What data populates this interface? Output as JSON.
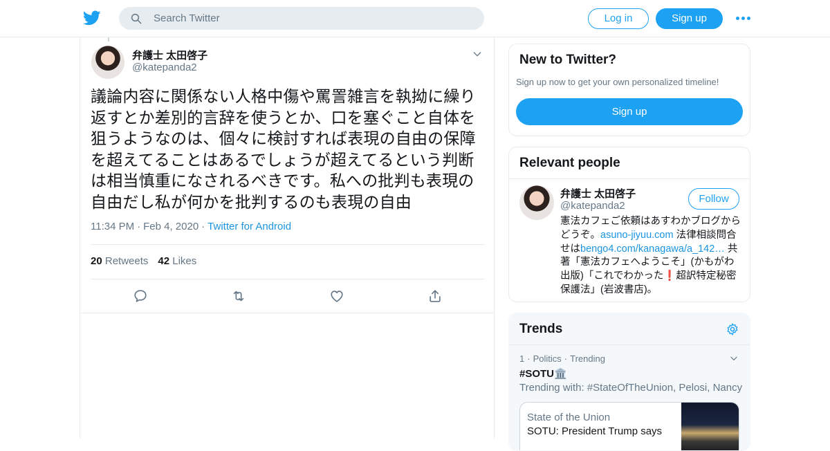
{
  "header": {
    "search_placeholder": "Search Twitter",
    "login_label": "Log in",
    "signup_label": "Sign up"
  },
  "tweet": {
    "author_name": "弁護士 太田啓子",
    "author_handle": "@katepanda2",
    "text": "議論内容に関係ない人格中傷や罵詈雑言を執拗に繰り返すとか差別的言辞を使うとか、口を塞ぐこと自体を狙うようなのは、個々に検討すれば表現の自由の保障を超えてることはあるでしょうが超えてるという判断は相当慎重になされるべきです。私への批判も表現の自由だし私が何かを批判するのも表現の自由",
    "time": "11:34 PM",
    "date": "Feb 4, 2020",
    "source": "Twitter for Android",
    "retweets_count": "20",
    "retweets_label": "Retweets",
    "likes_count": "42",
    "likes_label": "Likes"
  },
  "new_to_twitter": {
    "title": "New to Twitter?",
    "subtitle": "Sign up now to get your own personalized timeline!",
    "button": "Sign up"
  },
  "relevant_people": {
    "title": "Relevant people",
    "person": {
      "name": "弁護士 太田啓子",
      "handle": "@katepanda2",
      "follow_label": "Follow",
      "bio_part1": "憲法カフェご依頼はあすわかブログからどうぞ。",
      "bio_link1": "asuno-jiyuu.com",
      "bio_part2": " 法律相談問合せは",
      "bio_link2": "bengo4.com/kanagawa/a_142…",
      "bio_part3": " 共著「憲法カフェへようこそ」(かもがわ出版)「これでわかった",
      "bio_exclaim": "❗",
      "bio_part4": "超訳特定秘密保護法」(岩波書店)。"
    }
  },
  "trends": {
    "title": "Trends",
    "item": {
      "rank": "1",
      "category": "Politics",
      "status": "Trending",
      "tag": "#SOTU🏛️",
      "trending_with": "Trending with: #StateOfTheUnion, Pelosi, Nancy",
      "news_source": "State of the Union",
      "news_title": "SOTU: President Trump says"
    }
  },
  "colors": {
    "accent": "#1da1f2",
    "link": "#1b95e0",
    "secondary_text": "#657786"
  }
}
